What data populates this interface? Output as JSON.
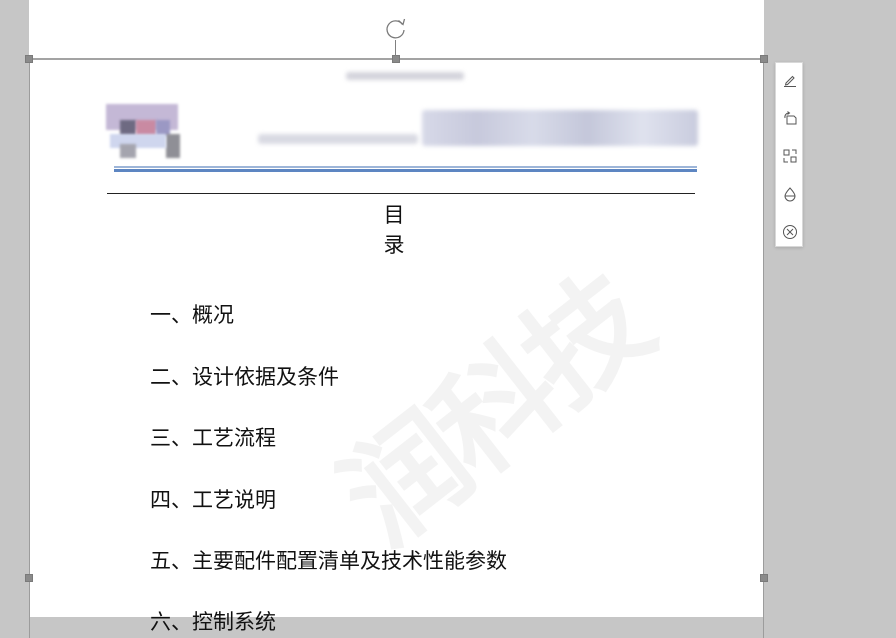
{
  "document": {
    "toc_title": "目　录",
    "toc_items": [
      "一、概况",
      "二、设计依据及条件",
      "三、工艺流程",
      "四、工艺说明",
      "五、主要配件配置清单及技术性能参数",
      "六、控制系统"
    ],
    "watermark_text": "润科技"
  },
  "image_toolbar": {
    "icons": [
      "edit-icon",
      "rotate-icon",
      "replace-icon",
      "fill-icon",
      "delete-icon"
    ]
  },
  "colors": {
    "background": "#c6c6c6",
    "page": "#ffffff",
    "header_rule_light": "#9db5d8",
    "header_rule_dark": "#5d86c2",
    "selection_handle": "#8a8a8a"
  }
}
